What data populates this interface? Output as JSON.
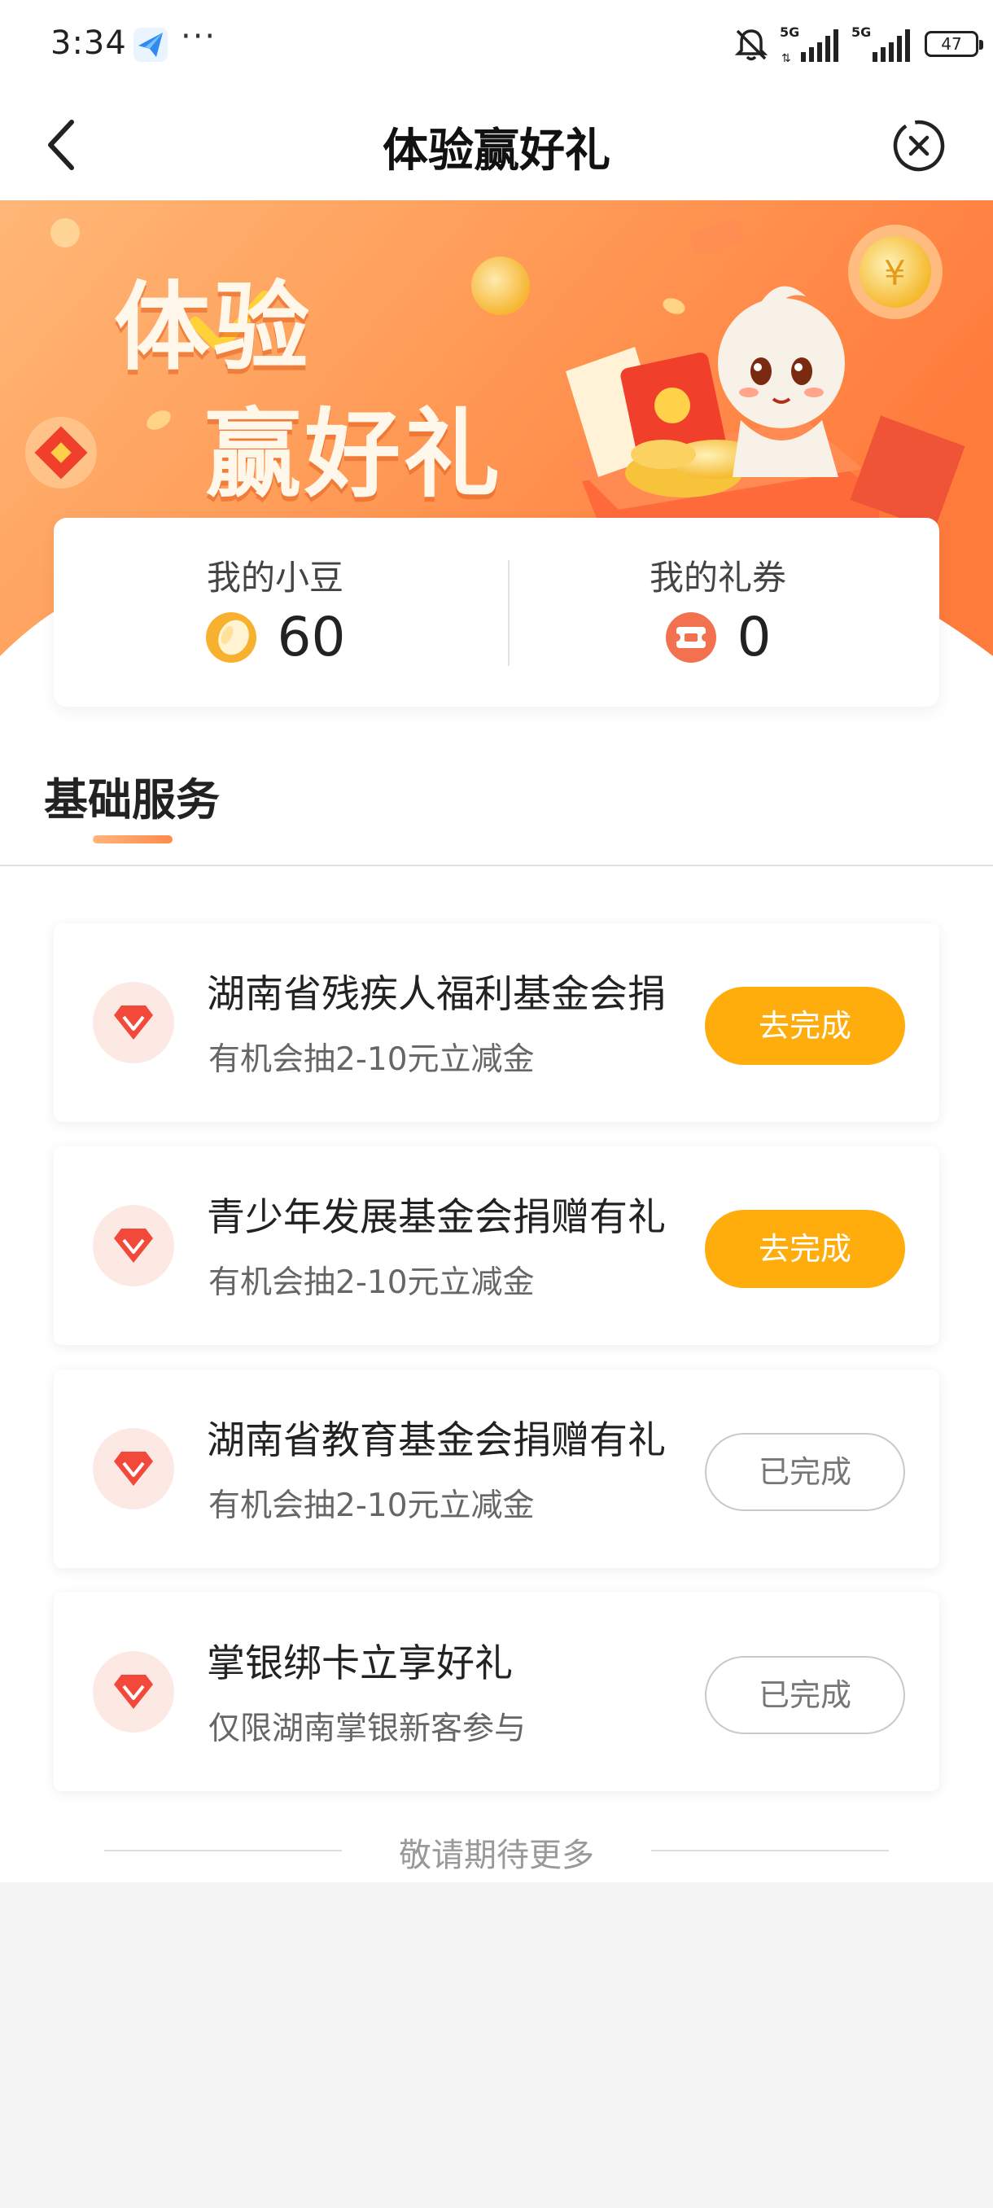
{
  "status_bar": {
    "time": "3:34",
    "more": "···",
    "network_a": "5G",
    "network_b": "5G",
    "battery": "47"
  },
  "nav": {
    "title": "体验赢好礼"
  },
  "banner": {
    "title_line1": "体验",
    "title_line2": "赢好礼"
  },
  "stats": {
    "beans_label": "我的小豆",
    "beans_value": "60",
    "coupons_label": "我的礼券",
    "coupons_value": "0"
  },
  "section": {
    "title": "基础服务"
  },
  "tasks": [
    {
      "title": "湖南省残疾人福利基金会捐",
      "subtitle": "有机会抽2-10元立减金",
      "button": "去完成",
      "status": "todo"
    },
    {
      "title": "青少年发展基金会捐赠有礼",
      "subtitle": "有机会抽2-10元立减金",
      "button": "去完成",
      "status": "todo"
    },
    {
      "title": "湖南省教育基金会捐赠有礼",
      "subtitle": "有机会抽2-10元立减金",
      "button": "已完成",
      "status": "done"
    },
    {
      "title": "掌银绑卡立享好礼",
      "subtitle": "仅限湖南掌银新客参与",
      "button": "已完成",
      "status": "done"
    }
  ],
  "footer": {
    "text": "敬请期待更多"
  },
  "colors": {
    "accent_orange": "#ff8a3d",
    "button_yellow": "#ffad0c",
    "icon_red": "#f2493a"
  },
  "icons": {
    "back": "chevron-left-icon",
    "close": "close-circle-icon",
    "bean": "bean-coin-icon",
    "coupon": "coupon-icon",
    "task": "diamond-icon"
  }
}
